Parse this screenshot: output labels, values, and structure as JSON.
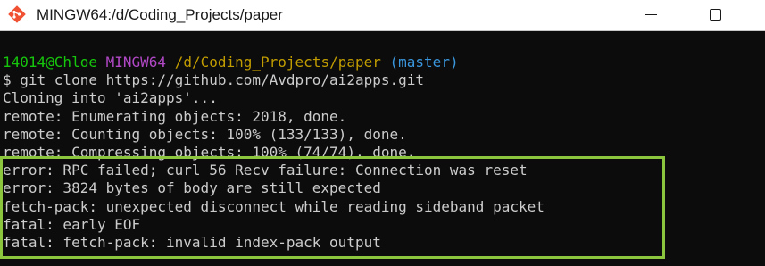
{
  "window": {
    "title": "MINGW64:/d/Coding_Projects/paper",
    "icon": "git-bash-icon"
  },
  "prompt": {
    "user_host": "14014@Chloe",
    "system": "MINGW64",
    "path": "/d/Coding_Projects/paper",
    "branch": "(master)"
  },
  "output_lines": [
    "$ git clone https://github.com/Avdpro/ai2apps.git",
    "Cloning into 'ai2apps'...",
    "remote: Enumerating objects: 2018, done.",
    "remote: Counting objects: 100% (133/133), done.",
    "remote: Compressing objects: 100% (74/74), done."
  ],
  "error_lines": [
    "error: RPC failed; curl 56 Recv failure: Connection was reset",
    "error: 3824 bytes of body are still expected",
    "fetch-pack: unexpected disconnect while reading sideband packet",
    "fatal: early EOF",
    "fatal: fetch-pack: invalid index-pack output"
  ],
  "colors": {
    "user": "#16c60c",
    "system": "#b148c6",
    "path": "#c19c00",
    "branch": "#3a96dd",
    "text": "#cccccc",
    "background": "#0c0c0c",
    "highlight_border": "#8cc63f"
  }
}
